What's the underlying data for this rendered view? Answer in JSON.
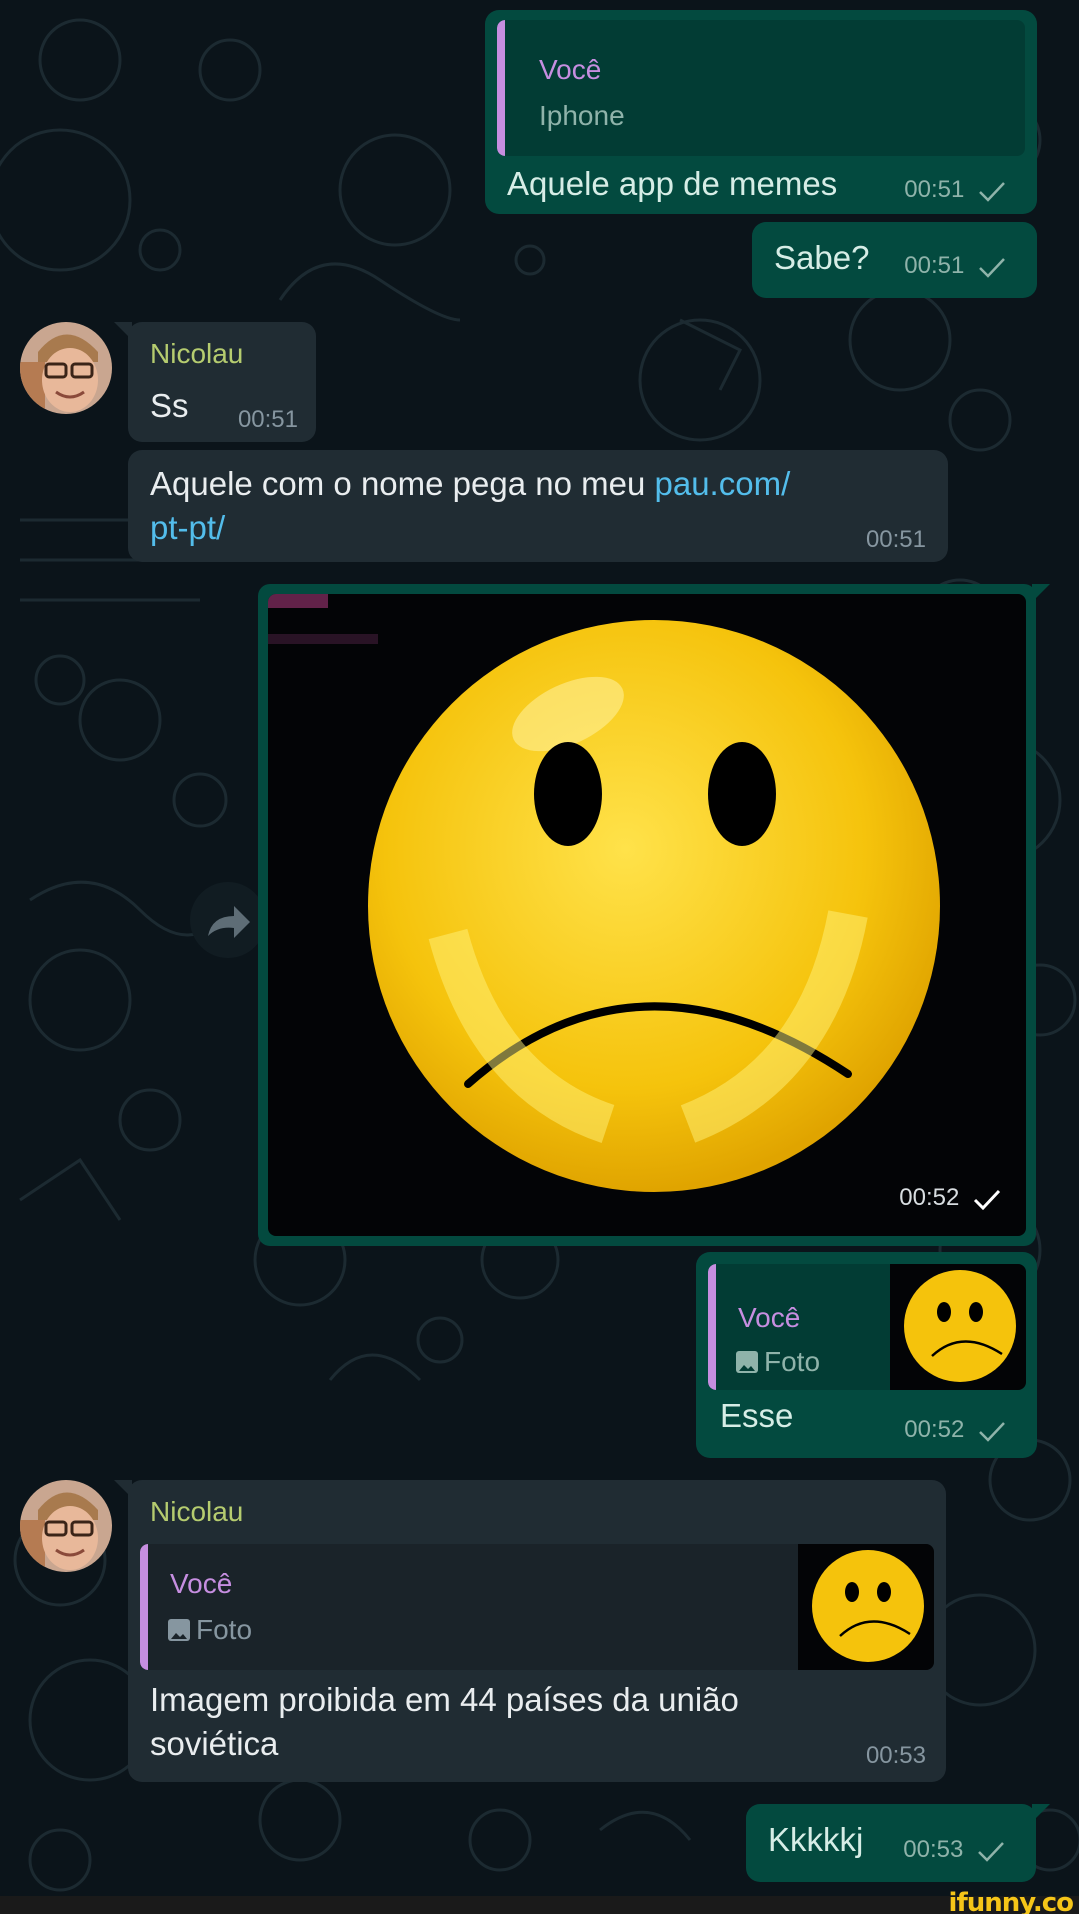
{
  "app": "WhatsApp",
  "colors": {
    "outgoing_bubble": "#034a3f",
    "incoming_bubble": "#202c33",
    "background": "#0b141a",
    "quote_author": "#c68ee0",
    "sender_name": "#b5cc6f",
    "link": "#53bdeb"
  },
  "messages": [
    {
      "direction": "outgoing",
      "quote": {
        "author": "Você",
        "text": "Iphone"
      },
      "text": "Aquele app de memes",
      "time": "00:51",
      "status": "sent-check-icon"
    },
    {
      "direction": "outgoing",
      "text": "Sabe?",
      "time": "00:51",
      "status": "sent-check-icon"
    },
    {
      "direction": "incoming",
      "sender": "Nicolau",
      "text": "Ss",
      "time": "00:51"
    },
    {
      "direction": "incoming",
      "text_before_link": "Aquele com o nome pega no meu ",
      "link_line1": "pau.com/",
      "link_line2": "pt-pt/",
      "time": "00:51"
    },
    {
      "direction": "outgoing",
      "type": "image",
      "image_description": "sad-face-emoji-image",
      "time": "00:52",
      "status": "sent-check-icon"
    },
    {
      "direction": "outgoing",
      "quote": {
        "author": "Você",
        "text": "Foto",
        "icon": "photo-icon"
      },
      "text": "Esse",
      "time": "00:52",
      "status": "sent-check-icon"
    },
    {
      "direction": "incoming",
      "sender": "Nicolau",
      "quote": {
        "author": "Você",
        "text": "Foto",
        "icon": "photo-icon"
      },
      "text_line1": "Imagem proibida em 44 países da união",
      "text_line2": "soviética",
      "time": "00:53"
    },
    {
      "direction": "outgoing",
      "text": "Kkkkkj",
      "time": "00:53",
      "status": "sent-check-icon"
    }
  ],
  "watermark": "ifunny.co"
}
